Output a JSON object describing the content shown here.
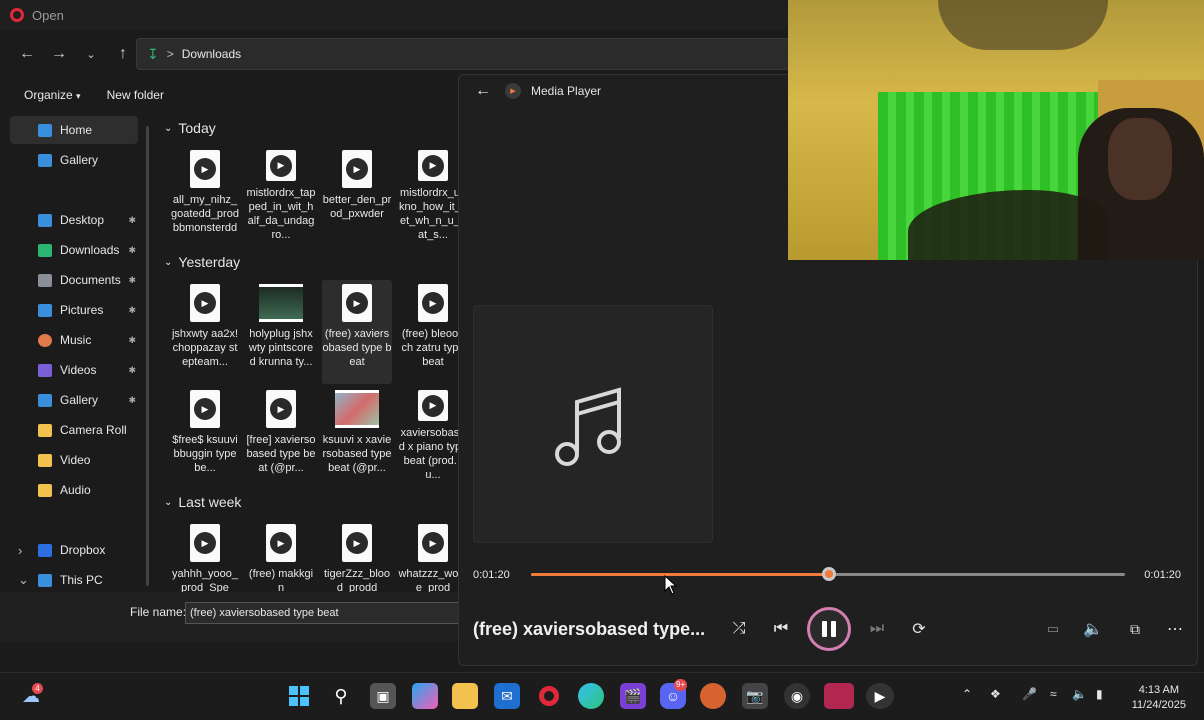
{
  "dialog": {
    "title": "Open"
  },
  "address": {
    "folder": "Downloads",
    "separator": ">"
  },
  "toolbar": {
    "organize": "Organize",
    "new_folder": "New folder"
  },
  "sidebar": {
    "items": [
      {
        "label": "Home",
        "icon": "home-icon",
        "color": "#3a8fdd",
        "pinned": false,
        "selected": true
      },
      {
        "label": "Gallery",
        "icon": "gallery-icon",
        "color": "#3a8fdd",
        "pinned": false
      },
      {
        "label": "Desktop",
        "icon": "desktop-icon",
        "color": "#3a8fdd",
        "pinned": true
      },
      {
        "label": "Downloads",
        "icon": "download-icon",
        "color": "#2bb673",
        "pinned": true
      },
      {
        "label": "Documents",
        "icon": "documents-icon",
        "color": "#8a8f98",
        "pinned": true
      },
      {
        "label": "Pictures",
        "icon": "pictures-icon",
        "color": "#3a8fdd",
        "pinned": true
      },
      {
        "label": "Music",
        "icon": "music-icon",
        "color": "#e07a4a",
        "pinned": true
      },
      {
        "label": "Videos",
        "icon": "videos-icon",
        "color": "#7b5fd6",
        "pinned": true
      },
      {
        "label": "Gallery",
        "icon": "gallery-icon",
        "color": "#3a8fdd",
        "pinned": true
      },
      {
        "label": "Camera Roll",
        "icon": "folder-icon",
        "color": "#f2c14e",
        "pinned": false
      },
      {
        "label": "Video",
        "icon": "folder-icon",
        "color": "#f2c14e",
        "pinned": false
      },
      {
        "label": "Audio",
        "icon": "folder-icon",
        "color": "#f2c14e",
        "pinned": false
      },
      {
        "label": "Dropbox",
        "icon": "dropbox-icon",
        "color": "#2d6fe0",
        "pinned": false
      },
      {
        "label": "This PC",
        "icon": "pc-icon",
        "color": "#3a8fdd",
        "pinned": false
      }
    ]
  },
  "groups": {
    "today": "Today",
    "yesterday": "Yesterday",
    "last_week": "Last week"
  },
  "files": [
    {
      "name": "all_my_nihz_goatedd_prodbbmonsterdd"
    },
    {
      "name": "mistlordrx_tapped_in_wit_half_da_undagro..."
    },
    {
      "name": "better_den_prod_pxwder"
    },
    {
      "name": "mistlordrx_u_kno_how_it_get_wh_n_u_gat_s..."
    },
    {
      "name": "jshxwty aa2x! choppazay stepteam..."
    },
    {
      "name": "holyplug jshxwty pintscored krunna ty..."
    },
    {
      "name": "(free) xaviersobased type beat"
    },
    {
      "name": "(free) bleood ch zatru type beat"
    },
    {
      "name": "$free$ ksuuvi bbuggin type be..."
    },
    {
      "name": "[free] xaviersobased type beat (@pr..."
    },
    {
      "name": "ksuuvi x xaviersobased type beat (@pr..."
    },
    {
      "name": "xaviersobased x piano type beat (prod. ju..."
    },
    {
      "name": "yahhh_yooo_prod_Spe"
    },
    {
      "name": "(free) makkgin"
    },
    {
      "name": "tigerZzz_blood_prodd"
    },
    {
      "name": "whatzzz_worse_prod"
    }
  ],
  "file_name": {
    "label": "File name:",
    "value": "(free) xaviersobased type beat"
  },
  "player": {
    "app_title": "Media Player",
    "song_title": "(free) xaviersobased type...",
    "current_time": "0:01:20",
    "total_time": "0:01:20",
    "progress": 0.502,
    "accent": "#f07b3c"
  },
  "taskbar": {
    "weather_badge": "4",
    "discord_badge": "9+",
    "time": "4:13 AM",
    "date": "11/24/2025"
  }
}
